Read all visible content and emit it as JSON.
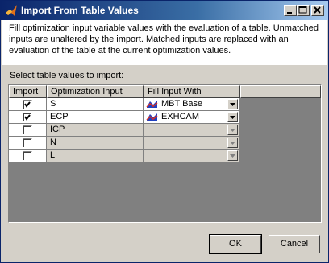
{
  "window": {
    "title": "Import From Table Values"
  },
  "description": "Fill optimization input variable values with the evaluation of a table. Unmatched inputs are unaltered by the import. Matched inputs are replaced with an evaluation of the table at the current optimization values.",
  "select_label": "Select table values to import:",
  "table": {
    "columns": [
      "Import",
      "Optimization Input",
      "Fill Input With"
    ],
    "rows": [
      {
        "checked": true,
        "input": "S",
        "fill": "MBT  Base",
        "enabled": true
      },
      {
        "checked": true,
        "input": "ECP",
        "fill": "EXHCAM",
        "enabled": true
      },
      {
        "checked": false,
        "input": "ICP",
        "fill": "",
        "enabled": false
      },
      {
        "checked": false,
        "input": "N",
        "fill": "",
        "enabled": false
      },
      {
        "checked": false,
        "input": "L",
        "fill": "",
        "enabled": false
      }
    ]
  },
  "buttons": {
    "ok": "OK",
    "cancel": "Cancel"
  },
  "icons": {
    "app": "matlab-icon",
    "fill": "table-icon"
  },
  "colors": {
    "titlebar": "#0a246a",
    "face": "#d4d0c8"
  }
}
